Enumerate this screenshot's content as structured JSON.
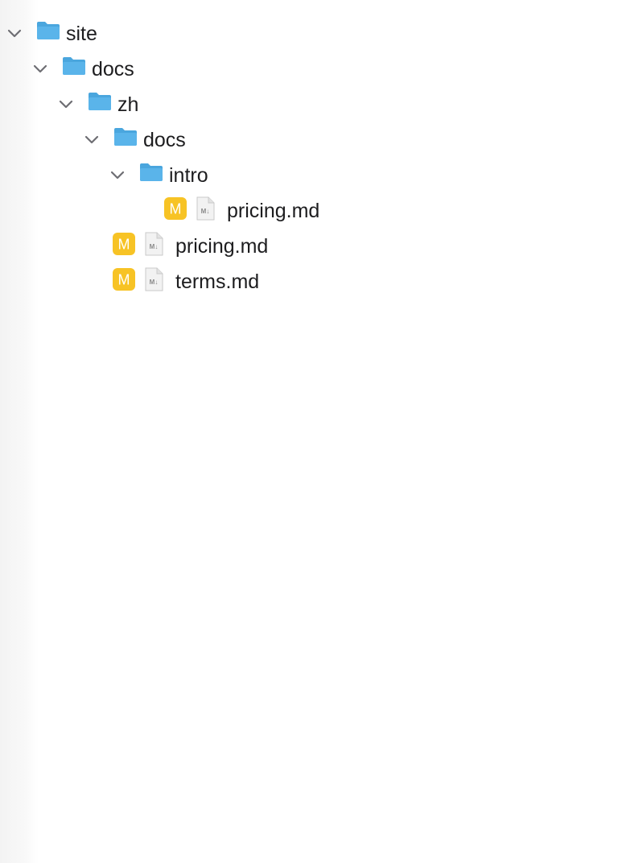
{
  "tree": {
    "site": {
      "name": "site",
      "expanded": true,
      "icon": "folder-icon"
    },
    "docs": {
      "name": "docs",
      "expanded": true,
      "icon": "folder-icon"
    },
    "zh": {
      "name": "zh",
      "expanded": true,
      "icon": "folder-icon"
    },
    "zh_docs": {
      "name": "docs",
      "expanded": true,
      "icon": "folder-icon"
    },
    "intro": {
      "name": "intro",
      "expanded": true,
      "icon": "folder-icon"
    },
    "intro_pricing": {
      "name": "pricing.md",
      "badge": "M",
      "icon": "markdown-file-icon"
    },
    "pricing": {
      "name": "pricing.md",
      "badge": "M",
      "icon": "markdown-file-icon"
    },
    "terms": {
      "name": "terms.md",
      "badge": "M",
      "icon": "markdown-file-icon"
    }
  },
  "colors": {
    "folder": "#5ab4ea",
    "folder_tab": "#4aa6de",
    "badge": "#f7c325",
    "chevron": "#6e6e73",
    "text": "#1d1d1f"
  }
}
